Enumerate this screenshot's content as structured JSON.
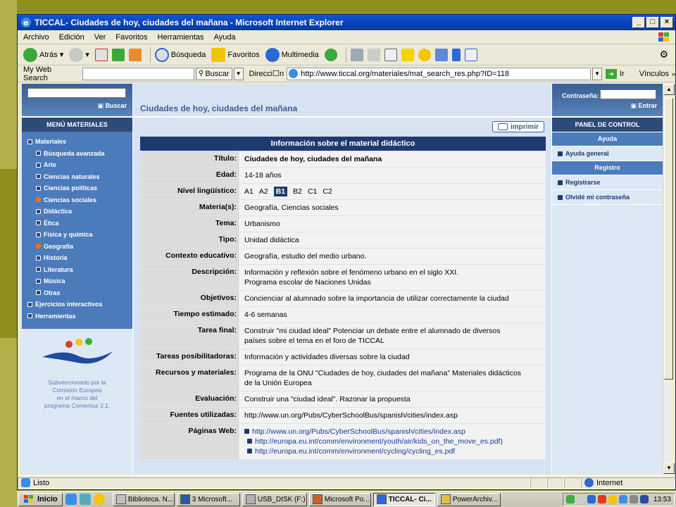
{
  "window": {
    "title": "TICCAL- Ciudades de hoy, ciudades del mañana - Microsoft Internet Explorer"
  },
  "menubar": [
    "Archivo",
    "Edición",
    "Ver",
    "Favoritos",
    "Herramientas",
    "Ayuda"
  ],
  "toolbar": {
    "back": "Atrás",
    "search": "Búsqueda",
    "favorites": "Favoritos",
    "multimedia": "Multimedia"
  },
  "searchbar": {
    "label": "My Web Search",
    "buscar": "Buscar",
    "address_label": "Direcci☐n",
    "url": "http://www.ticcal.org/materiales/mat_search_res.php?ID=118",
    "go": "Ir",
    "links": "Vínculos"
  },
  "left": {
    "search_button": "Buscar",
    "menu_title": "MENÚ MATERIALES",
    "items": [
      {
        "label": "Materiales",
        "level": 1,
        "active": false
      },
      {
        "label": "Búsqueda avanzada",
        "level": 2,
        "active": false
      },
      {
        "label": "Arte",
        "level": 2,
        "active": false
      },
      {
        "label": "Ciencias naturales",
        "level": 2,
        "active": false
      },
      {
        "label": "Ciencias políticas",
        "level": 2,
        "active": false
      },
      {
        "label": "Ciencias sociales",
        "level": 2,
        "active": true
      },
      {
        "label": "Didáctica",
        "level": 2,
        "active": false
      },
      {
        "label": "Ética",
        "level": 2,
        "active": false
      },
      {
        "label": "Física y química",
        "level": 2,
        "active": false
      },
      {
        "label": "Geografía",
        "level": 2,
        "active": true
      },
      {
        "label": "Historia",
        "level": 2,
        "active": false
      },
      {
        "label": "Literatura",
        "level": 2,
        "active": false
      },
      {
        "label": "Música",
        "level": 2,
        "active": false
      },
      {
        "label": "Otras",
        "level": 2,
        "active": false
      },
      {
        "label": "Ejercicios interactivos",
        "level": 1,
        "active": false
      },
      {
        "label": "Herramientas",
        "level": 1,
        "active": false
      }
    ],
    "eu_text": [
      "Subvencionado por la",
      "Comisión Europea",
      "en el marco del",
      "programa Comenius 2.1."
    ]
  },
  "center": {
    "page_title": "Ciudades de hoy, ciudades del mañana",
    "print": "imprimir",
    "table_header": "Información sobre el material didáctico",
    "levels": [
      "A1",
      "A2",
      "B1",
      "B2",
      "C1",
      "C2"
    ],
    "selected_level": "B1",
    "rows": [
      {
        "key": "Título:",
        "value": "Ciudades de hoy, ciudades del mañana",
        "bold": true
      },
      {
        "key": "Edad:",
        "value": "14-18 años"
      },
      {
        "key": "Nivel lingüístico:",
        "value": ""
      },
      {
        "key": "Materia(s):",
        "value": "Geografía, Ciencias sociales"
      },
      {
        "key": "Tema:",
        "value": "Urbanismo"
      },
      {
        "key": "Tipo:",
        "value": "Unidad didáctica"
      },
      {
        "key": "Contexto educativo:",
        "value": "Geografía, estudio del medio urbano."
      },
      {
        "key": "Descripción:",
        "value": "Información y reflexión sobre el fenómeno urbano en el siglo XXI.\nPrograma escolar de Naciones Unidas"
      },
      {
        "key": "Objetivos:",
        "value": "Concienciar al alumnado sobre la importancia de utilizar correctamente la ciudad"
      },
      {
        "key": "Tiempo estimado:",
        "value": "4-6 semanas"
      },
      {
        "key": "Tarea final:",
        "value": "Construir \"mi ciudad ideal\" Potenciar un debate entre el alumnado de diversos\npaíses sobre el tema en el foro de TICCAL"
      },
      {
        "key": "Tareas posibilitadoras:",
        "value": "Información y actividades diversas sobre la ciudad"
      },
      {
        "key": "Recursos y materiales:",
        "value": "Programa de la ONU \"Ciudades de hoy, ciudades del mañana\" Materiales didácticos\nde la Unión Europea"
      },
      {
        "key": "Evaluación:",
        "value": "Construir una \"ciudad ideal\". Razonar la propuesta"
      },
      {
        "key": "Fuentes utilizadas:",
        "value": "http://www.un.org/Pubs/CyberSchoolBus/spanish/cities/index.asp"
      }
    ],
    "web_pages_key": "Páginas Web:",
    "web_pages": [
      "http://www.un.org/Pubs/CyberSchoolBus/spanish/cities/index.asp",
      "http://europa.eu.int/comm/environment/youth/air/kids_on_the_move_es.pdf)",
      "http://europa.eu.int/comm/environment/cycling/cycling_es.pdf"
    ]
  },
  "right": {
    "password_label": "Contraseña:",
    "enter": "Entrar",
    "panel_title": "PANEL DE CONTROL",
    "help_section": "Ayuda",
    "help_item": "Ayuda general",
    "register_section": "Registro",
    "register_item": "Registrarse",
    "forgot_item": "Olvidé mi contraseña"
  },
  "status": {
    "text": "Listo",
    "zone": "Internet"
  },
  "taskbar": {
    "start": "Inicio",
    "tasks": [
      {
        "label": "Biblioteca. N...",
        "active": false,
        "color": "#c0c0c0"
      },
      {
        "label": "3 Microsoft...",
        "active": false,
        "color": "#2a5aa8"
      },
      {
        "label": "USB_DISK (F:)",
        "active": false,
        "color": "#b0b0b0"
      },
      {
        "label": "Microsoft Po...",
        "active": false,
        "color": "#d06020"
      },
      {
        "label": "TICCAL- Ci...",
        "active": true,
        "color": "#2a6ad8"
      },
      {
        "label": "PowerArchiv...",
        "active": false,
        "color": "#e0c040"
      }
    ],
    "clock": "13:53"
  }
}
